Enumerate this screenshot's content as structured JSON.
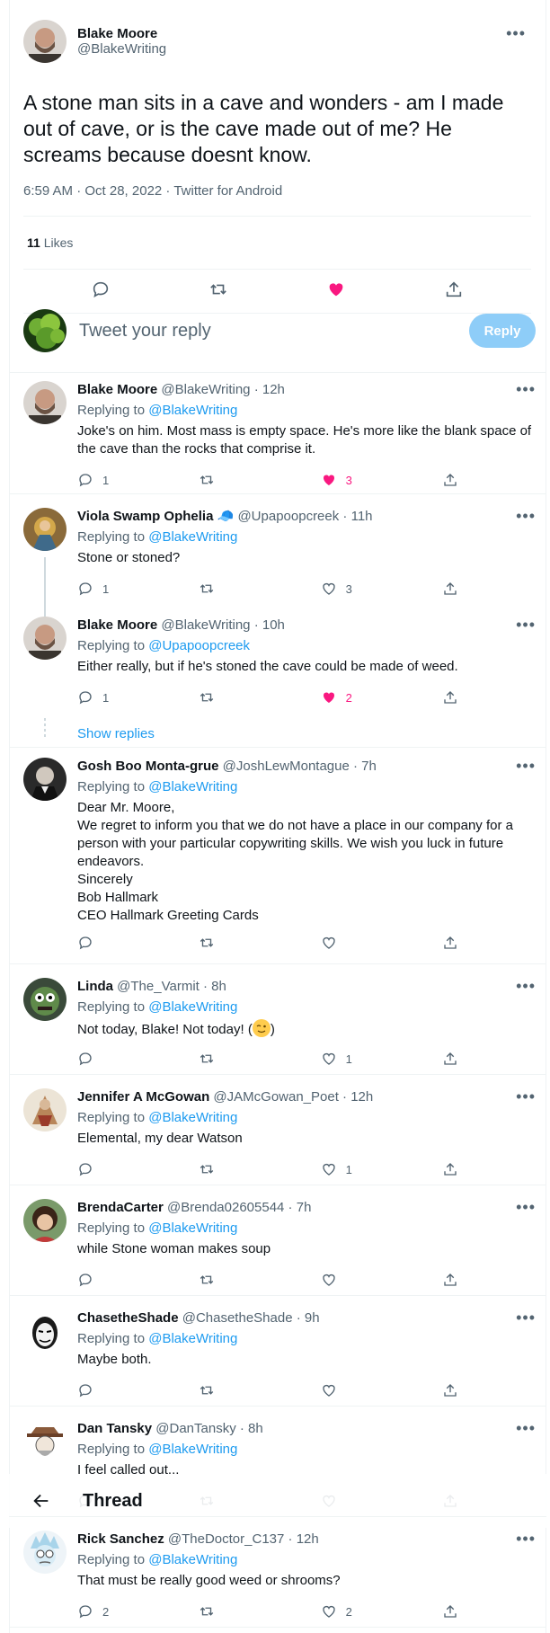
{
  "main_tweet": {
    "author_name": "Blake Moore",
    "author_handle": "@BlakeWriting",
    "text": "A stone man sits in a cave and wonders - am I made out of cave, or is the cave made out of me? He screams because doesnt know.",
    "meta": "6:59 AM · Oct 28, 2022 · Twitter for Android",
    "likes_count": "11",
    "likes_label": "Likes"
  },
  "composer": {
    "placeholder": "Tweet your reply",
    "reply_label": "Reply"
  },
  "replies": [
    {
      "name": "Blake Moore",
      "handle": "@BlakeWriting",
      "time": "12h",
      "replying_prefix": "Replying to",
      "replying_to": "@BlakeWriting",
      "text": "Joke's on him. Most mass is empty space. He's more like the blank space of the cave than the rocks that comprise it.",
      "reply_count": "1",
      "retweet_count": "",
      "like_count": "3",
      "liked": true
    },
    {
      "name": "Viola Swamp Ophelia 🧢",
      "handle": "@Upapoopcreek",
      "time": "11h",
      "replying_prefix": "Replying to",
      "replying_to": "@BlakeWriting",
      "text": "Stone or stoned?",
      "reply_count": "1",
      "retweet_count": "",
      "like_count": "3",
      "liked": false
    },
    {
      "name": "Blake Moore",
      "handle": "@BlakeWriting",
      "time": "10h",
      "replying_prefix": "Replying to",
      "replying_to": "@Upapoopcreek",
      "text": "Either really, but if he's stoned the cave could be made of weed.",
      "reply_count": "1",
      "retweet_count": "",
      "like_count": "2",
      "liked": true
    },
    {
      "name": "Gosh Boo Monta-grue",
      "handle": "@JoshLewMontague",
      "time": "7h",
      "replying_prefix": "Replying to",
      "replying_to": "@BlakeWriting",
      "text_lines": [
        "Dear Mr. Moore,",
        "We regret to inform you that we do not have a place in our company for a person with your particular copywriting skills. We wish you luck in future endeavors.",
        "Sincerely",
        "Bob Hallmark",
        "CEO Hallmark Greeting Cards"
      ],
      "reply_count": "",
      "retweet_count": "",
      "like_count": "",
      "liked": false
    },
    {
      "name": "Linda",
      "handle": "@The_Varmit",
      "time": "8h",
      "replying_prefix": "Replying to",
      "replying_to": "@BlakeWriting",
      "text": "Not today, Blake!  Not today!  (",
      "text_after": ")",
      "reply_count": "",
      "retweet_count": "",
      "like_count": "1",
      "liked": false
    },
    {
      "name": "Jennifer A McGowan",
      "handle": "@JAMcGowan_Poet",
      "time": "12h",
      "replying_prefix": "Replying to",
      "replying_to": "@BlakeWriting",
      "text": "Elemental, my dear Watson",
      "reply_count": "",
      "retweet_count": "",
      "like_count": "1",
      "liked": false
    },
    {
      "name": "BrendaCarter",
      "handle": "@Brenda02605544",
      "time": "7h",
      "replying_prefix": "Replying to",
      "replying_to": "@BlakeWriting",
      "text": "while Stone woman makes soup",
      "reply_count": "",
      "retweet_count": "",
      "like_count": "",
      "liked": false
    },
    {
      "name": "ChasetheShade",
      "handle": "@ChasetheShade",
      "time": "9h",
      "replying_prefix": "Replying to",
      "replying_to": "@BlakeWriting",
      "text": "Maybe both.",
      "reply_count": "",
      "retweet_count": "",
      "like_count": "",
      "liked": false
    },
    {
      "name": "Dan Tansky",
      "handle": "@DanTansky",
      "time": "8h",
      "replying_prefix": "Replying to",
      "replying_to": "@BlakeWriting",
      "text": "I feel called out...",
      "reply_count": "",
      "retweet_count": "",
      "like_count": "",
      "liked": false
    },
    {
      "name": "Rick Sanchez",
      "handle": "@TheDoctor_C137",
      "time": "12h",
      "replying_prefix": "Replying to",
      "replying_to": "@BlakeWriting",
      "text": "That must be really good weed or shrooms?",
      "reply_count": "2",
      "retweet_count": "",
      "like_count": "2",
      "liked": false
    }
  ],
  "show_replies_label": "Show replies",
  "header": {
    "title": "Thread"
  },
  "colors": {
    "accent": "#1d9bf0",
    "like": "#f91880",
    "muted": "#536471",
    "reply_button": "#8ecdf8"
  },
  "icons": [
    "more-icon",
    "reply-icon",
    "retweet-icon",
    "like-icon",
    "share-icon",
    "back-arrow-icon"
  ]
}
